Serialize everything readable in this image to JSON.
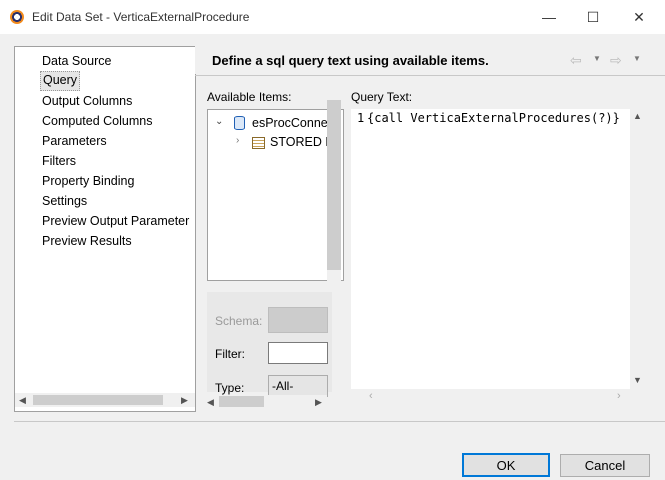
{
  "window": {
    "title": "Edit Data Set - VerticaExternalProcedure",
    "minimize_glyph": "—",
    "maximize_glyph": "☐",
    "close_glyph": "✕"
  },
  "nav": {
    "items": [
      {
        "label": "Data Source",
        "selected": false
      },
      {
        "label": "Query",
        "selected": true
      },
      {
        "label": "Output Columns",
        "selected": false
      },
      {
        "label": "Computed Columns",
        "selected": false
      },
      {
        "label": "Parameters",
        "selected": false
      },
      {
        "label": "Filters",
        "selected": false
      },
      {
        "label": "Property Binding",
        "selected": false
      },
      {
        "label": "Settings",
        "selected": false
      },
      {
        "label": "Preview Output Parameter",
        "selected": false
      },
      {
        "label": "Preview Results",
        "selected": false
      }
    ]
  },
  "page": {
    "heading": "Define a sql query text using available items.",
    "back_icon": "back-arrow-icon",
    "forward_icon": "forward-arrow-icon"
  },
  "available": {
    "label": "Available Items:",
    "tree": [
      {
        "label": "esProcConne",
        "icon": "database-icon",
        "expanded": true
      },
      {
        "label": "STORED P",
        "icon": "table-icon",
        "expanded": false
      }
    ],
    "schema_label": "Schema:",
    "filter_label": "Filter:",
    "filter_value": "",
    "type_label": "Type:",
    "type_value": "-All-"
  },
  "query": {
    "label": "Query Text:",
    "line_number": "1",
    "text": "{call VerticaExternalProcedures(?)}"
  },
  "buttons": {
    "ok": "OK",
    "cancel": "Cancel"
  },
  "colors": {
    "accent": "#0078d7",
    "db_icon": "#1f5fb4"
  }
}
